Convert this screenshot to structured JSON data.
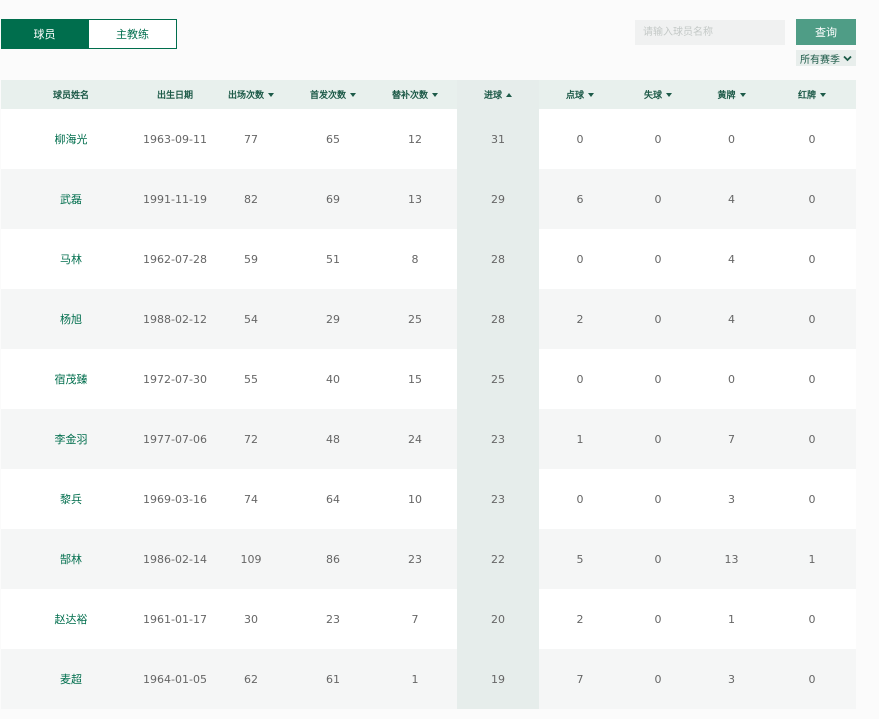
{
  "tabs": [
    {
      "label": "球员",
      "active": true
    },
    {
      "label": "主教练",
      "active": false
    }
  ],
  "search": {
    "placeholder": "请输入球员名称",
    "value": ""
  },
  "query_button": "查询",
  "season_filter": {
    "label": "所有赛季",
    "icon": "chevron-down-icon"
  },
  "columns": [
    {
      "label": "球员姓名",
      "sort": "none"
    },
    {
      "label": "出生日期",
      "sort": "none"
    },
    {
      "label": "出场次数",
      "sort": "desc"
    },
    {
      "label": "首发次数",
      "sort": "desc"
    },
    {
      "label": "替补次数",
      "sort": "desc"
    },
    {
      "label": "进球",
      "sort": "asc"
    },
    {
      "label": "点球",
      "sort": "desc"
    },
    {
      "label": "失球",
      "sort": "desc"
    },
    {
      "label": "黄牌",
      "sort": "desc"
    },
    {
      "label": "红牌",
      "sort": "desc"
    }
  ],
  "rows": [
    [
      "柳海光",
      "1963-09-11",
      "77",
      "65",
      "12",
      "31",
      "0",
      "0",
      "0",
      "0"
    ],
    [
      "武磊",
      "1991-11-19",
      "82",
      "69",
      "13",
      "29",
      "6",
      "0",
      "4",
      "0"
    ],
    [
      "马林",
      "1962-07-28",
      "59",
      "51",
      "8",
      "28",
      "0",
      "0",
      "4",
      "0"
    ],
    [
      "杨旭",
      "1988-02-12",
      "54",
      "29",
      "25",
      "28",
      "2",
      "0",
      "4",
      "0"
    ],
    [
      "宿茂臻",
      "1972-07-30",
      "55",
      "40",
      "15",
      "25",
      "0",
      "0",
      "0",
      "0"
    ],
    [
      "李金羽",
      "1977-07-06",
      "72",
      "48",
      "24",
      "23",
      "1",
      "0",
      "7",
      "0"
    ],
    [
      "黎兵",
      "1969-03-16",
      "74",
      "64",
      "10",
      "23",
      "0",
      "0",
      "3",
      "0"
    ],
    [
      "郜林",
      "1986-02-14",
      "109",
      "86",
      "23",
      "22",
      "5",
      "0",
      "13",
      "1"
    ],
    [
      "赵达裕",
      "1961-01-17",
      "30",
      "23",
      "7",
      "20",
      "2",
      "0",
      "1",
      "0"
    ],
    [
      "麦超",
      "1964-01-05",
      "62",
      "61",
      "1",
      "19",
      "7",
      "0",
      "3",
      "0"
    ]
  ],
  "colors": {
    "brand": "#006e4d",
    "button": "#4f9d86",
    "header_bg": "#e8f0ed",
    "sorted_col": "#e6edeb"
  }
}
